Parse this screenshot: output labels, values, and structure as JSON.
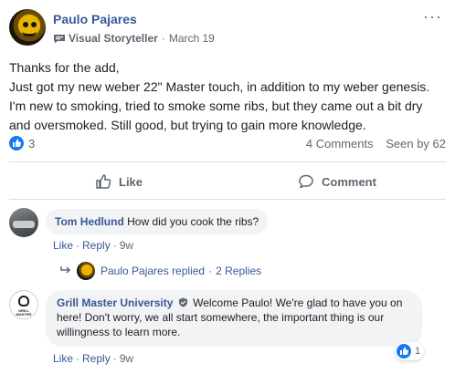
{
  "post": {
    "author": "Paulo Pajares",
    "badge_label": "Visual Storyteller",
    "separator": "·",
    "date": "March 19",
    "text_lines": [
      "Thanks for the add,",
      "Just got my new weber 22\" Master touch, in addition to my weber genesis.",
      "I'm new to smoking, tried to smoke some ribs, but they came out a bit dry",
      "and oversmoked. Still good, but trying to gain more knowledge."
    ],
    "like_count": "3",
    "comments_count": "4 Comments",
    "seen_by": "Seen by 62",
    "like_label": "Like",
    "comment_label": "Comment"
  },
  "comments": [
    {
      "author": "Tom Hedlund",
      "text": "How did you cook the ribs?",
      "like": "Like",
      "reply": "Reply",
      "time": "9w",
      "replies": {
        "author": "Paulo Pajares",
        "replied": "replied",
        "count": "2 Replies"
      }
    },
    {
      "author": "Grill Master University",
      "text": "Welcome Paulo! We're glad to have you on here! Don't worry, we all start somewhere, the important thing is our willingness to learn more.",
      "like": "Like",
      "reply": "Reply",
      "time": "9w",
      "reaction_count": "1",
      "avatar_text": "GRILL MASTER"
    }
  ],
  "colors": {
    "link": "#385898",
    "like_blue": "#1877f2",
    "meta_gray": "#606770",
    "bubble_bg": "#f2f3f5"
  },
  "icons": {
    "badge": "visual-storyteller-badge-icon",
    "like_reaction": "thumbs-up-reaction-icon",
    "like_action": "thumbs-up-outline-icon",
    "comment_action": "speech-bubble-icon",
    "menu": "more-options-icon",
    "reply": "reply-arrow-icon",
    "admin_badge": "admin-shield-icon"
  }
}
